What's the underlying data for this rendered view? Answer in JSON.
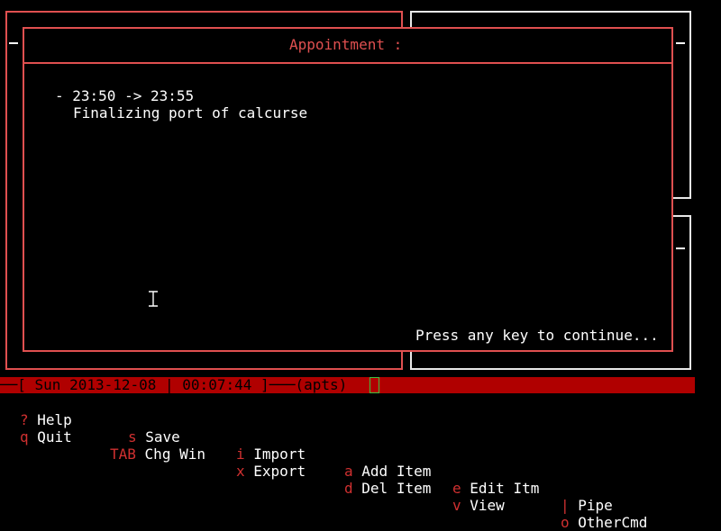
{
  "popup": {
    "title": "Appointment :",
    "time_range": "- 23:50 -> 23:55",
    "description": "Finalizing port of calcurse",
    "continue_prompt": "Press any key to continue..."
  },
  "status_bar": {
    "text": "──[ Sun 2013-12-08 | 00:07:44 ]───(apts)"
  },
  "help_row1": [
    {
      "key": "?",
      "label": "Help"
    },
    {
      "key": "s",
      "label": "Save"
    },
    {
      "key": "i",
      "label": "Import"
    },
    {
      "key": "a",
      "label": "Add Item"
    },
    {
      "key": "e",
      "label": "Edit Itm"
    },
    {
      "key": "|",
      "label": "Pipe"
    }
  ],
  "help_row2": [
    {
      "key": "q",
      "label": "Quit"
    },
    {
      "key": "TAB",
      "label": "Chg Win"
    },
    {
      "key": "x",
      "label": "Export"
    },
    {
      "key": "d",
      "label": "Del Item"
    },
    {
      "key": "v",
      "label": "View"
    },
    {
      "key": "o",
      "label": "OtherCmd"
    }
  ],
  "colors": {
    "background": "#000000",
    "accent_red": "#e05050",
    "status_bar": "#b00000",
    "cursor_green": "#40c040",
    "foreground": "#ffffff"
  }
}
